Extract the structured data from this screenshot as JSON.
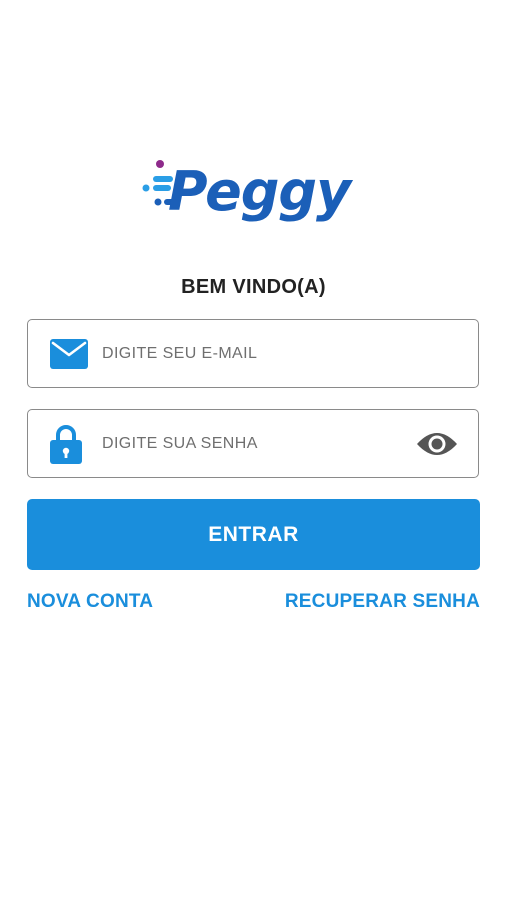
{
  "logo": {
    "text": "Peggy",
    "brand_color": "#1b5fb8",
    "accent_color": "#8e2a8b",
    "light_color": "#2a9ee6"
  },
  "welcome": "BEM VINDO(A)",
  "email_field": {
    "placeholder": "DIGITE SEU E-MAIL",
    "value": "",
    "icon": "envelope-icon"
  },
  "password_field": {
    "placeholder": "DIGITE SUA SENHA",
    "value": "",
    "icon": "lock-icon",
    "toggle_icon": "eye-icon"
  },
  "enter_button": {
    "label": "ENTRAR",
    "color": "#1a8edc"
  },
  "links": {
    "new_account": "NOVA CONTA",
    "recover_password": "RECUPERAR SENHA"
  }
}
